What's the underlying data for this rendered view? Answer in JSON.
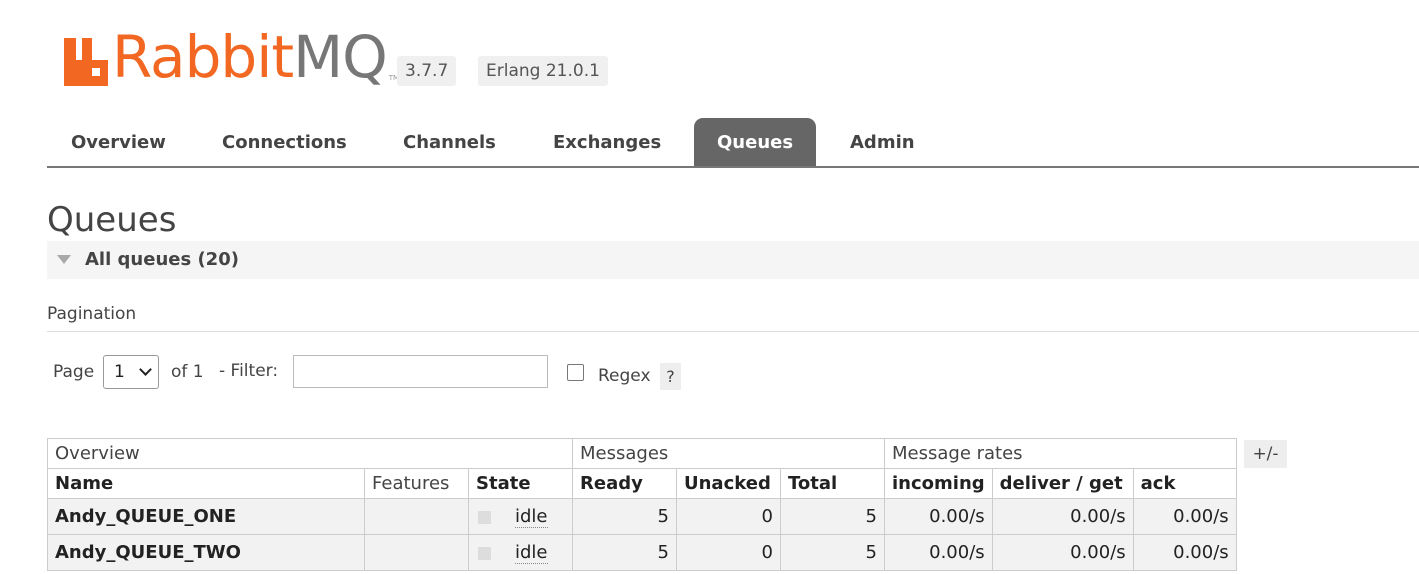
{
  "brand": {
    "name_rabbit": "Rabbit",
    "name_mq": "MQ",
    "tm": "TM",
    "version": "3.7.7",
    "erlang": "Erlang 21.0.1",
    "accent_color": "#f26722"
  },
  "nav": {
    "items": [
      {
        "label": "Overview"
      },
      {
        "label": "Connections"
      },
      {
        "label": "Channels"
      },
      {
        "label": "Exchanges"
      },
      {
        "label": "Queues",
        "active": true
      },
      {
        "label": "Admin"
      }
    ]
  },
  "page": {
    "title": "Queues",
    "section_label": "All queues (20)"
  },
  "pagination": {
    "heading": "Pagination",
    "page_label": "Page",
    "page_value": "1",
    "of_label": "of 1",
    "filter_label": "- Filter:",
    "filter_value": "",
    "regex_label": "Regex",
    "regex_checked": false,
    "help_label": "?"
  },
  "table": {
    "groups": [
      "Overview",
      "Messages",
      "Message rates"
    ],
    "columns": [
      "Name",
      "Features",
      "State",
      "Ready",
      "Unacked",
      "Total",
      "incoming",
      "deliver / get",
      "ack"
    ],
    "plus_minus": "+/-",
    "rows": [
      {
        "name": "Andy_QUEUE_ONE",
        "features": "",
        "state": "idle",
        "ready": "5",
        "unacked": "0",
        "total": "5",
        "incoming": "0.00/s",
        "deliver_get": "0.00/s",
        "ack": "0.00/s"
      },
      {
        "name": "Andy_QUEUE_TWO",
        "features": "",
        "state": "idle",
        "ready": "5",
        "unacked": "0",
        "total": "5",
        "incoming": "0.00/s",
        "deliver_get": "0.00/s",
        "ack": "0.00/s"
      }
    ]
  }
}
